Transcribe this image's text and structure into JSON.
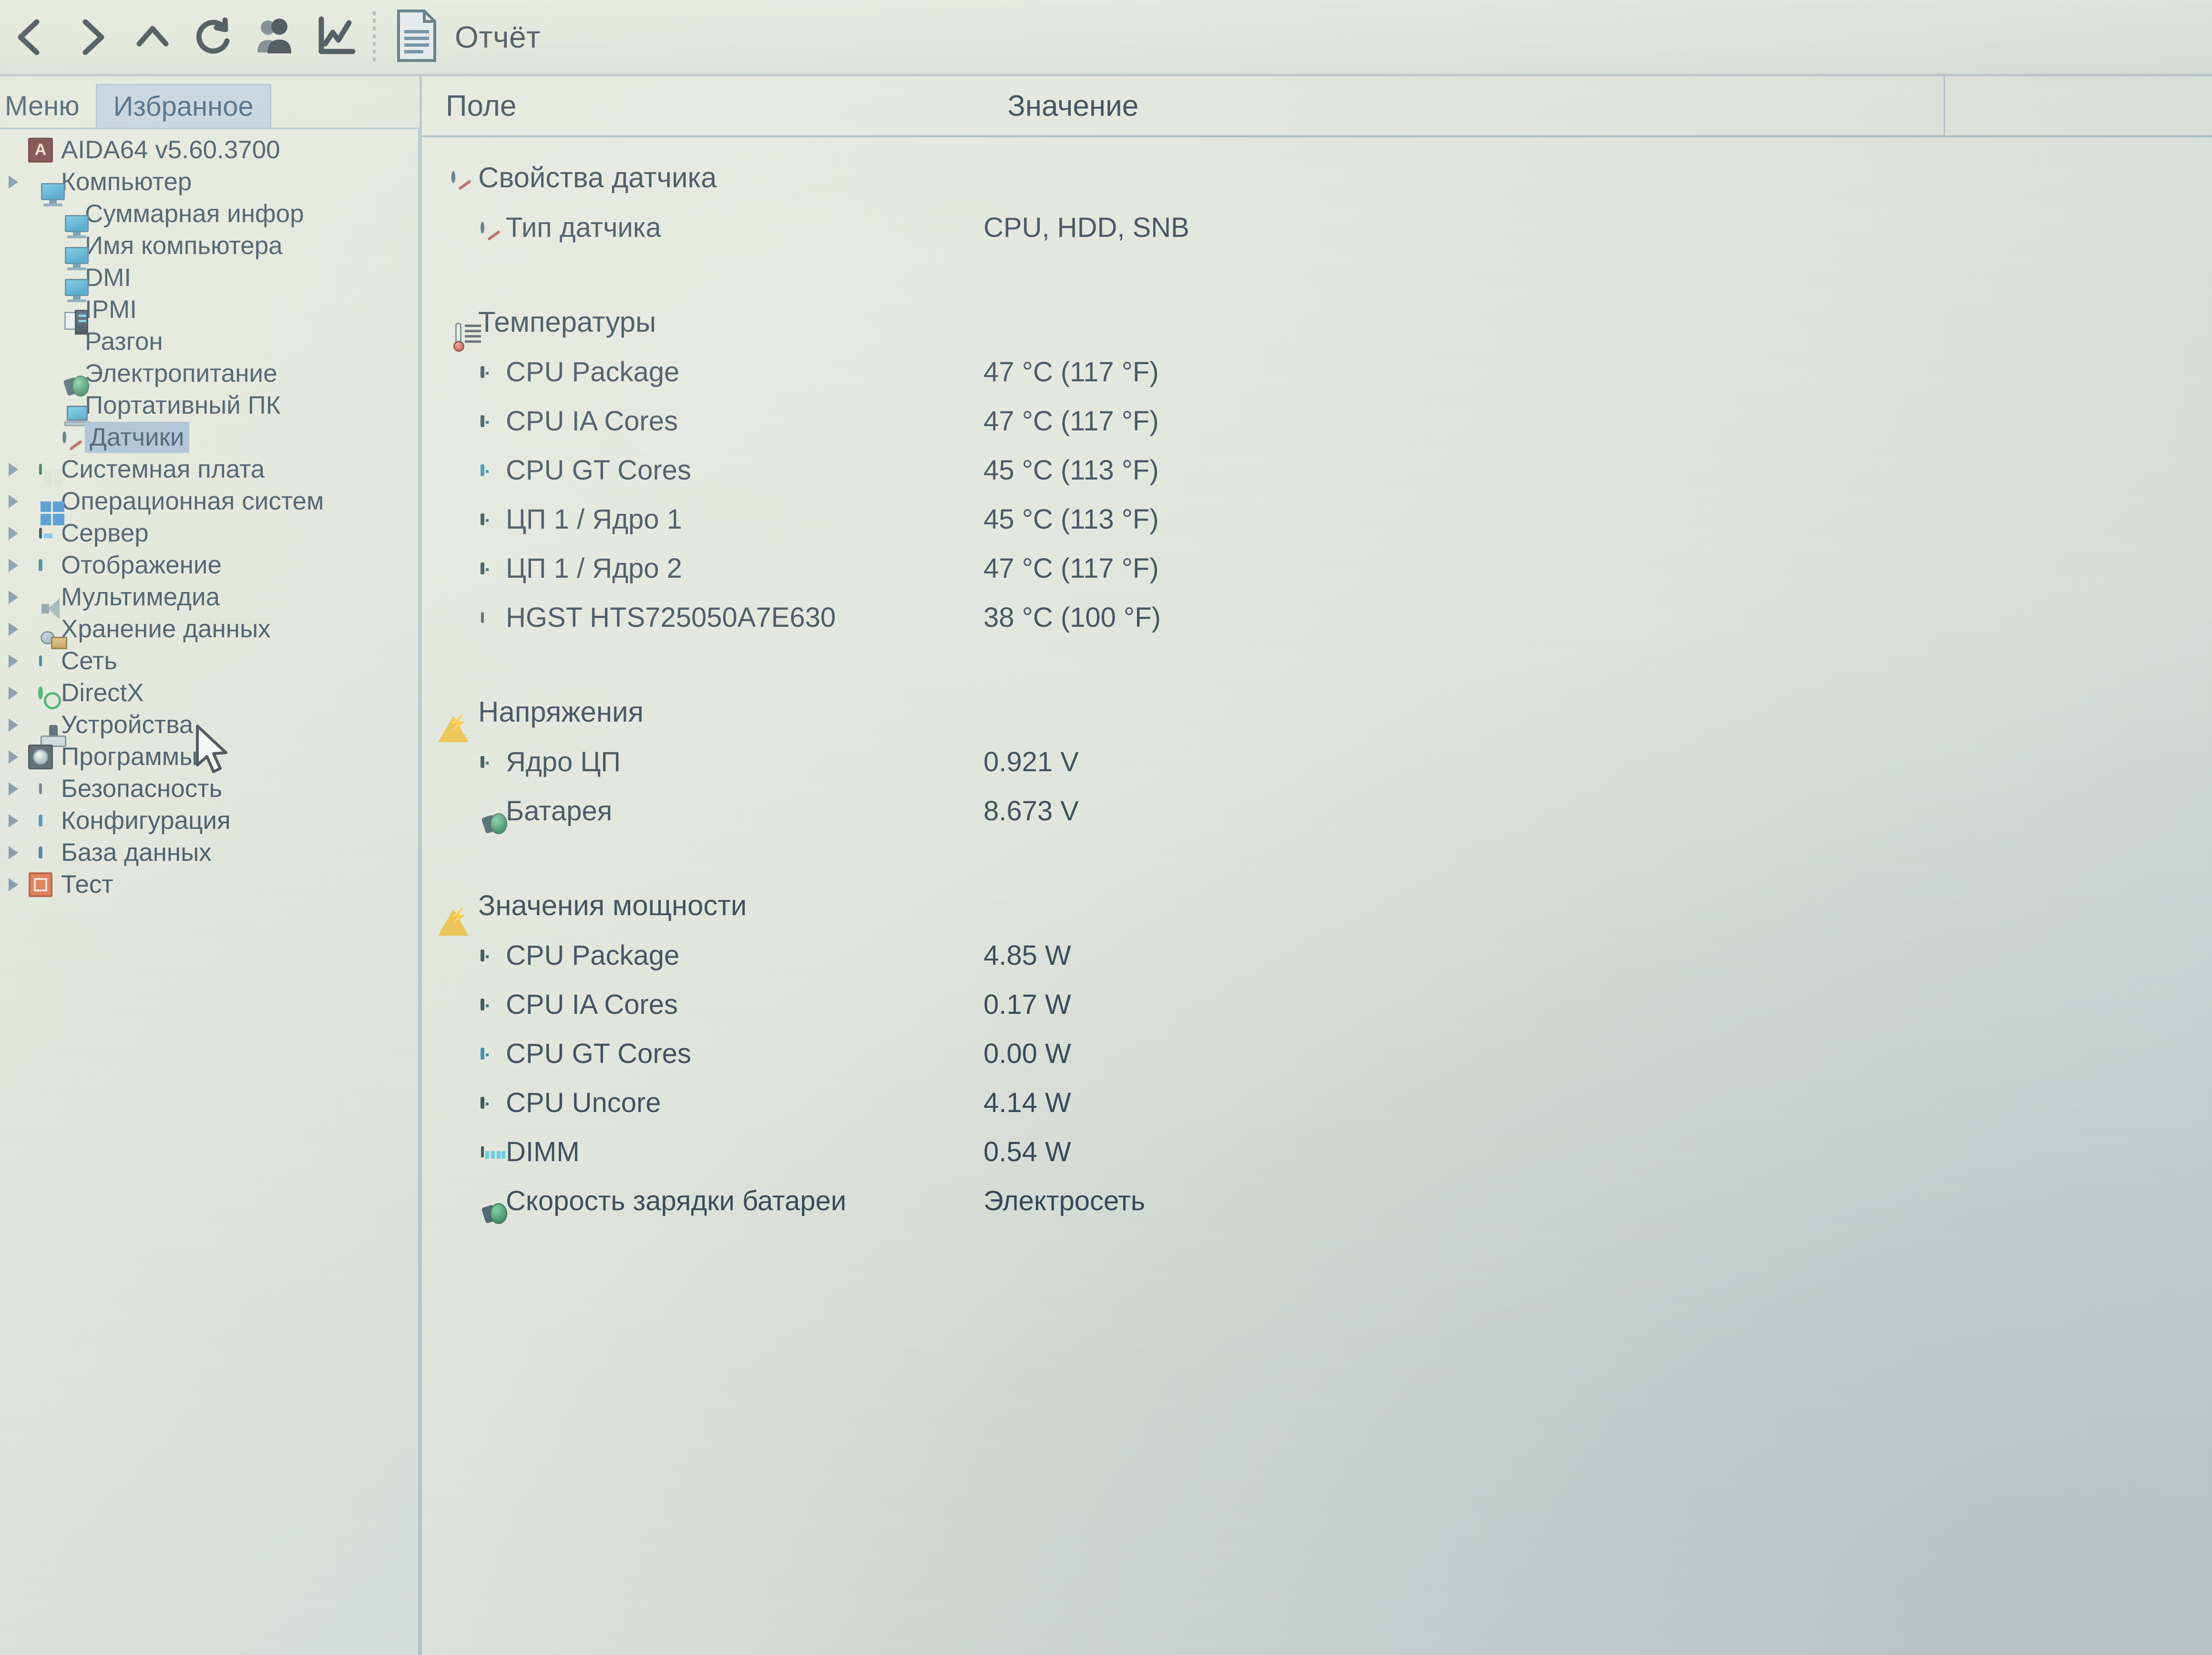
{
  "app": {
    "title": "AIDA64 v5.60.3700"
  },
  "toolbar": {
    "buttons": [
      {
        "name": "back",
        "icon": "chevron-left-icon"
      },
      {
        "name": "forward",
        "icon": "chevron-right-icon"
      },
      {
        "name": "up",
        "icon": "chevron-up-icon"
      },
      {
        "name": "refresh",
        "icon": "refresh-icon"
      },
      {
        "name": "users",
        "icon": "users-icon"
      },
      {
        "name": "graph",
        "icon": "line-chart-icon"
      }
    ],
    "report": {
      "label": "Отчёт",
      "icon": "document-icon"
    }
  },
  "tabs": [
    {
      "label": "Меню",
      "active": false
    },
    {
      "label": "Избранное",
      "active": true
    }
  ],
  "tree": {
    "root": {
      "label": "AIDA64 v5.60.3700",
      "icon": "aida64-icon"
    },
    "items": [
      {
        "label": "Компьютер",
        "icon": "monitor-icon",
        "depth": 1,
        "expander": true,
        "selected": false
      },
      {
        "label": "Суммарная инфор",
        "icon": "monitor-icon",
        "depth": 2,
        "expander": false,
        "selected": false
      },
      {
        "label": "Имя компьютера",
        "icon": "monitor-icon",
        "depth": 2,
        "expander": false,
        "selected": false
      },
      {
        "label": "DMI",
        "icon": "monitor-icon",
        "depth": 2,
        "expander": false,
        "selected": false
      },
      {
        "label": "IPMI",
        "icon": "ipmi-icon",
        "depth": 2,
        "expander": false,
        "selected": false
      },
      {
        "label": "Разгон",
        "icon": "flame-icon",
        "depth": 2,
        "expander": false,
        "selected": false
      },
      {
        "label": "Электропитание",
        "icon": "power-plug-icon",
        "depth": 2,
        "expander": false,
        "selected": false
      },
      {
        "label": "Портативный ПК",
        "icon": "laptop-icon",
        "depth": 2,
        "expander": false,
        "selected": false
      },
      {
        "label": "Датчики",
        "icon": "sensor-icon",
        "depth": 2,
        "expander": false,
        "selected": true
      },
      {
        "label": "Системная плата",
        "icon": "motherboard-icon",
        "depth": 1,
        "expander": true,
        "selected": false
      },
      {
        "label": "Операционная систем",
        "icon": "windows-icon",
        "depth": 1,
        "expander": true,
        "selected": false
      },
      {
        "label": "Сервер",
        "icon": "server-icon",
        "depth": 1,
        "expander": true,
        "selected": false
      },
      {
        "label": "Отображение",
        "icon": "display-icon",
        "depth": 1,
        "expander": true,
        "selected": false
      },
      {
        "label": "Мультимедиа",
        "icon": "speaker-icon",
        "depth": 1,
        "expander": true,
        "selected": false
      },
      {
        "label": "Хранение данных",
        "icon": "storage-icon",
        "depth": 1,
        "expander": true,
        "selected": false
      },
      {
        "label": "Сеть",
        "icon": "network-icon",
        "depth": 1,
        "expander": true,
        "selected": false
      },
      {
        "label": "DirectX",
        "icon": "directx-icon",
        "depth": 1,
        "expander": true,
        "selected": false
      },
      {
        "label": "Устройства",
        "icon": "devices-icon",
        "depth": 1,
        "expander": true,
        "selected": false
      },
      {
        "label": "Программы",
        "icon": "programs-icon",
        "depth": 1,
        "expander": true,
        "selected": false
      },
      {
        "label": "Безопасность",
        "icon": "shield-icon",
        "depth": 1,
        "expander": true,
        "selected": false
      },
      {
        "label": "Конфигурация",
        "icon": "config-icon",
        "depth": 1,
        "expander": true,
        "selected": false
      },
      {
        "label": "База данных",
        "icon": "database-icon",
        "depth": 1,
        "expander": true,
        "selected": false
      },
      {
        "label": "Тест",
        "icon": "test-icon",
        "depth": 1,
        "expander": true,
        "selected": false
      }
    ]
  },
  "columns": {
    "field": "Поле",
    "value": "Значение"
  },
  "sections": [
    {
      "title": "Свойства датчика",
      "icon": "sensor-icon",
      "rows": [
        {
          "label": "Тип датчика",
          "value": "CPU, HDD, SNB",
          "icon": "sensor-icon"
        }
      ]
    },
    {
      "title": "Температуры",
      "icon": "thermometer-icon",
      "rows": [
        {
          "label": "CPU Package",
          "value": "47 °C  (117 °F)",
          "icon": "cpu-chip-icon"
        },
        {
          "label": "CPU IA Cores",
          "value": "47 °C  (117 °F)",
          "icon": "cpu-chip-icon"
        },
        {
          "label": "CPU GT Cores",
          "value": "45 °C  (113 °F)",
          "icon": "gpu-chip-icon"
        },
        {
          "label": "ЦП 1 / Ядро 1",
          "value": "45 °C  (113 °F)",
          "icon": "cpu-chip-icon"
        },
        {
          "label": "ЦП 1 / Ядро 2",
          "value": "47 °C  (117 °F)",
          "icon": "cpu-chip-icon"
        },
        {
          "label": "HGST HTS725050A7E630",
          "value": "38 °C  (100 °F)",
          "icon": "hdd-icon"
        }
      ]
    },
    {
      "title": "Напряжения",
      "icon": "warning-bolt-icon",
      "rows": [
        {
          "label": "Ядро ЦП",
          "value": "0.921 V",
          "icon": "cpu-chip-icon"
        },
        {
          "label": "Батарея",
          "value": "8.673 V",
          "icon": "battery-plug-icon"
        }
      ]
    },
    {
      "title": "Значения мощности",
      "icon": "warning-bolt-icon",
      "rows": [
        {
          "label": "CPU Package",
          "value": "4.85 W",
          "icon": "cpu-chip-icon"
        },
        {
          "label": "CPU IA Cores",
          "value": "0.17 W",
          "icon": "cpu-chip-icon"
        },
        {
          "label": "CPU GT Cores",
          "value": "0.00 W",
          "icon": "gpu-chip-icon"
        },
        {
          "label": "CPU Uncore",
          "value": "4.14 W",
          "icon": "cpu-chip-icon"
        },
        {
          "label": "DIMM",
          "value": "0.54 W",
          "icon": "dimm-icon"
        },
        {
          "label": "Скорость зарядки батареи",
          "value": "Электросеть",
          "icon": "battery-plug-icon"
        }
      ]
    }
  ],
  "colors": {
    "window_bg": "#e5eadd",
    "selection": "#9ab8d4",
    "tab_active": "#bfd1e2",
    "text": "#15293a",
    "accent_blue": "#2b6c96"
  }
}
